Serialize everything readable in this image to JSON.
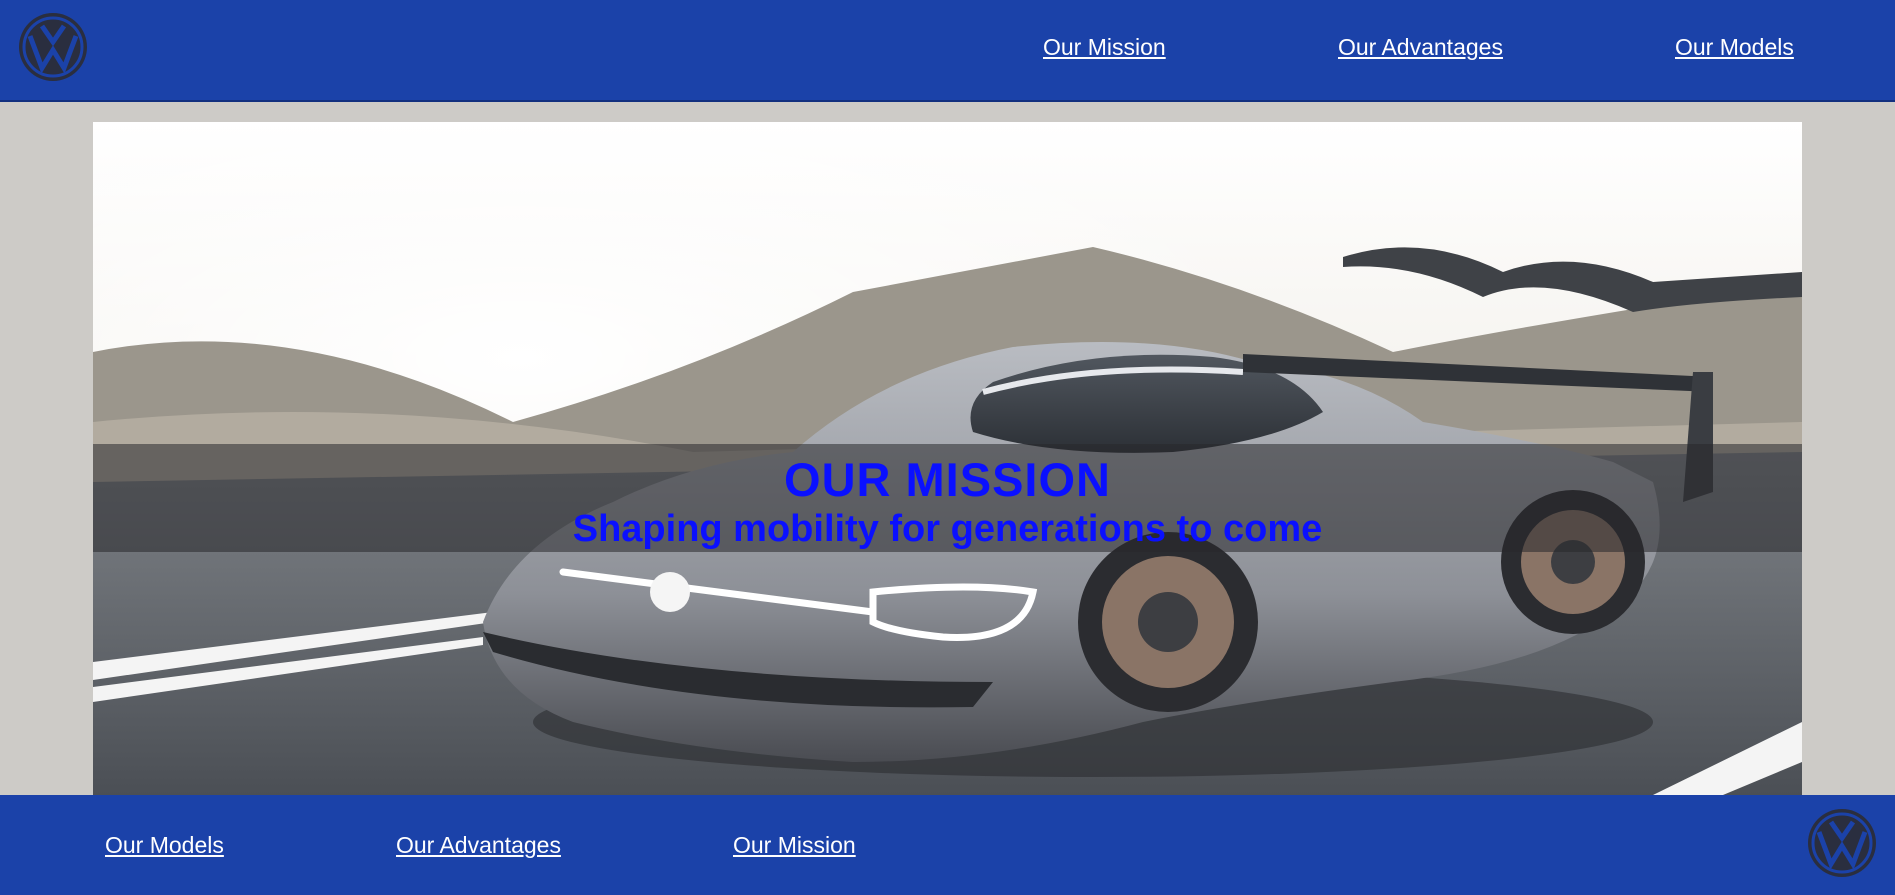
{
  "header": {
    "logo_icon": "volkswagen-logo",
    "nav": {
      "mission": "Our Mission",
      "advantages": "Our Advantages",
      "models": "Our Models"
    }
  },
  "hero": {
    "image": "silver electric race car on a mountain road",
    "title": "OUR MISSION",
    "subtitle": "Shaping mobility for generations to come"
  },
  "footer": {
    "nav": {
      "models": "Our Models",
      "advantages": "Our Advantages",
      "mission": "Our Mission"
    },
    "logo_icon": "volkswagen-logo"
  },
  "colors": {
    "brand_blue": "#1b42a9",
    "page_background": "#cdcbc7",
    "hero_text": "#0a10ff",
    "nav_text": "#ffffff"
  }
}
